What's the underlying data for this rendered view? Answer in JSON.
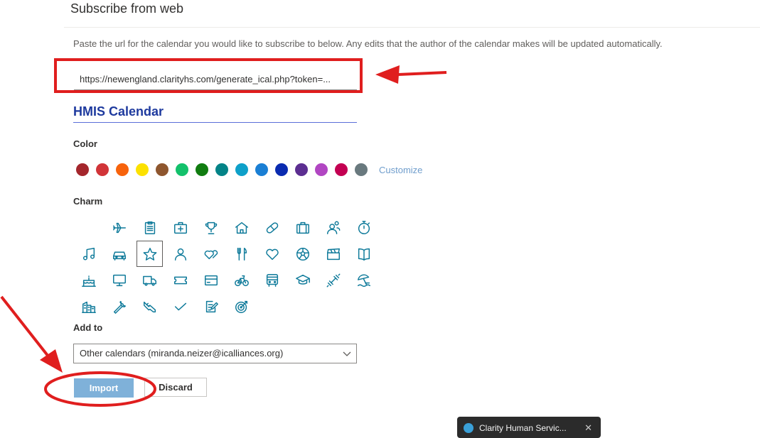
{
  "dialog": {
    "title": "Subscribe from web",
    "description": "Paste the url for the calendar you would like to subscribe to below. Any edits that the author of the calendar makes will be updated automatically.",
    "url_value": "https://newengland.clarityhs.com/generate_ical.php?token=...",
    "calendar_name": "HMIS Calendar",
    "color_label": "Color",
    "colors": [
      "#a4262c",
      "#d13438",
      "#f7630c",
      "#fce100",
      "#8e562e",
      "#13c16b",
      "#107c10",
      "#038387",
      "#0ea0c9",
      "#1a7fd4",
      "#0a2bb0",
      "#5c2e91",
      "#b146c2",
      "#c30052",
      "#69797e"
    ],
    "customize_label": "Customize",
    "charm_label": "Charm",
    "add_to_label": "Add to",
    "add_to_value": "Other calendars (miranda.neizer@icalliances.org)",
    "import_label": "Import",
    "discard_label": "Discard"
  },
  "toast": {
    "text": "Clarity Human Servic..."
  },
  "annotations": {
    "color": "#e01e1e"
  }
}
